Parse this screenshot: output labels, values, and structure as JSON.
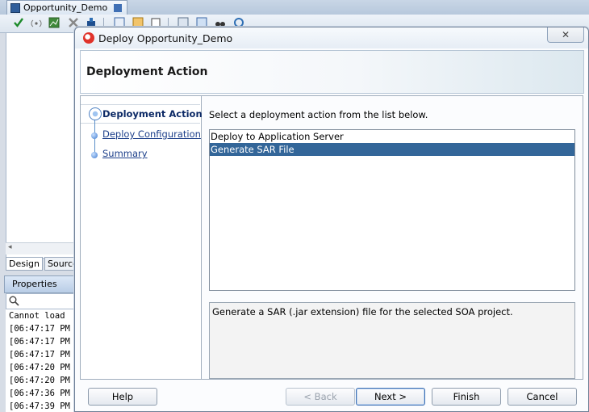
{
  "ide": {
    "tab_title": "Opportunity_Demo",
    "design_tab": "Design",
    "source_tab": "Source",
    "properties_label": "Properties",
    "scroll_left_arrow": "◂",
    "log_lines": [
      "Cannot load",
      "[06:47:17 PM",
      "[06:47:17 PM",
      "[06:47:17 PM",
      "[06:47:20 PM",
      "[06:47:20 PM",
      "[06:47:36 PM",
      "[06:47:39 PM"
    ]
  },
  "dialog": {
    "title": "Deploy Opportunity_Demo",
    "close_glyph": "✕",
    "header_title": "Deployment Action",
    "steps": [
      {
        "label": "Deployment Action",
        "state": "active"
      },
      {
        "label": "Deploy Configuration",
        "state": "link"
      },
      {
        "label": "Summary",
        "state": "link"
      }
    ],
    "instruction": "Select a deployment action from the list below.",
    "actions": [
      {
        "label": "Deploy to Application Server",
        "selected": false
      },
      {
        "label": "Generate SAR File",
        "selected": true
      }
    ],
    "description": "Generate a SAR (.jar extension) file for the selected SOA project.",
    "buttons": {
      "help": "Help",
      "back": "< Back",
      "next": "Next >",
      "finish": "Finish",
      "cancel": "Cancel"
    }
  },
  "colors": {
    "selection": "#336699",
    "step_link": "#1d3f8a"
  }
}
